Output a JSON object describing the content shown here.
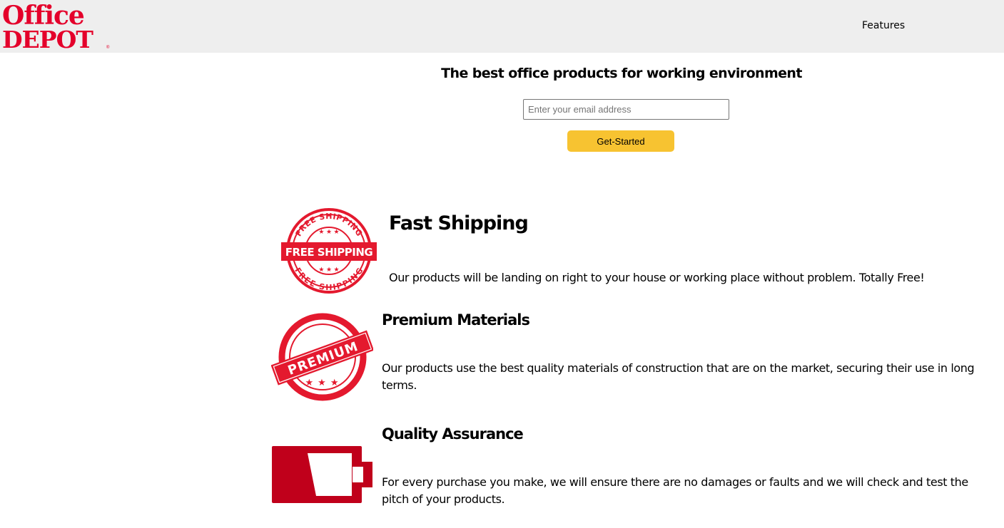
{
  "header": {
    "logo_line1": "Office",
    "logo_line2": "DEPOT",
    "logo_reg": "®",
    "nav": {
      "features": "Features"
    }
  },
  "hero": {
    "title": "The best office products for working environment",
    "email_placeholder": "Enter your email address",
    "cta_label": "Get-Started"
  },
  "features": [
    {
      "title": "Fast Shipping",
      "text": "Our products will be landing on right to your house or working place without problem. Totally Free!",
      "icon": "free-shipping-stamp-icon",
      "icon_text": "FREE SHIPPING"
    },
    {
      "title": "Premium Materials",
      "text": "Our products use the best quality materials of construction that are on the market, securing their use in long terms.",
      "icon": "premium-stamp-icon",
      "icon_text": "PREMIUM"
    },
    {
      "title": "Quality Assurance",
      "text": "For every purchase you make, we will ensure there are no damages or faults and we will check and test the pitch of your products.",
      "icon": "battery-icon"
    }
  ],
  "colors": {
    "brand_red": "#e4002b",
    "header_bg": "#eeeeee",
    "cta_yellow": "#f7c331",
    "icon_red": "#c0001b"
  }
}
